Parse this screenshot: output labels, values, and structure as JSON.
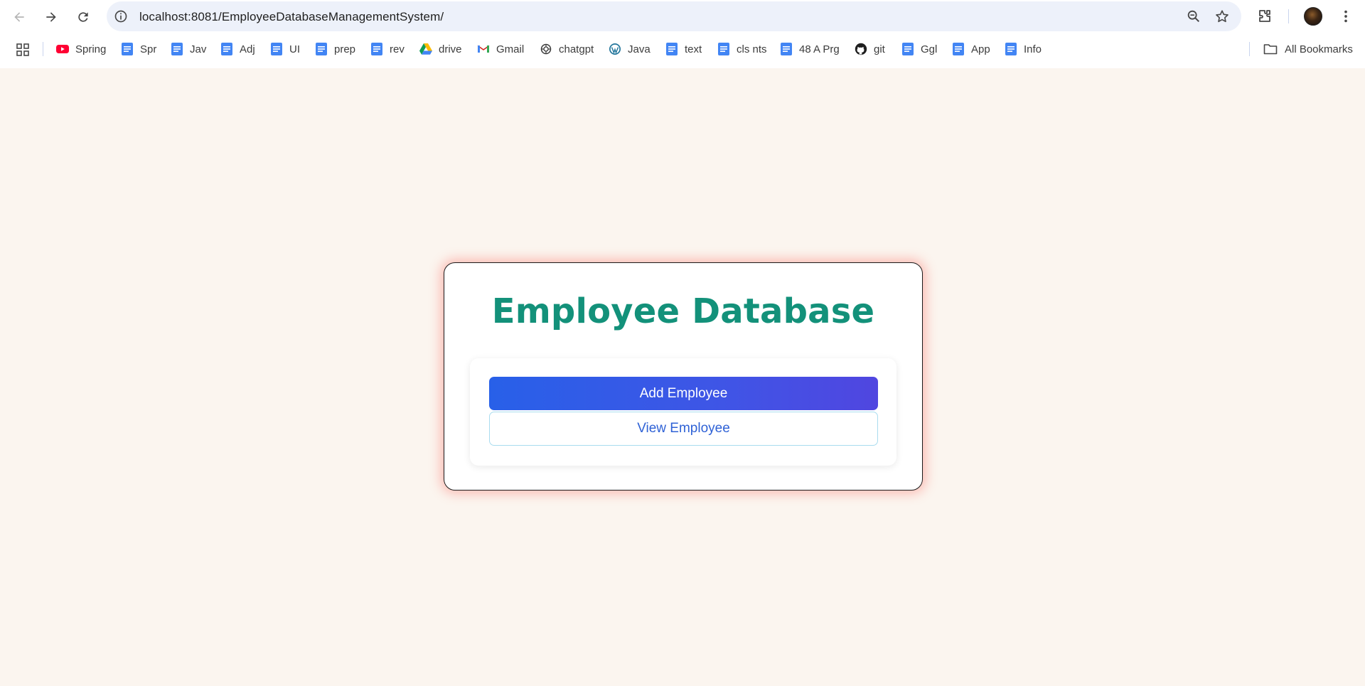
{
  "browser": {
    "url": "localhost:8081/EmployeeDatabaseManagementSystem/",
    "bookmarks": [
      {
        "label": "Spring",
        "icon": "youtube-icon"
      },
      {
        "label": "Spr",
        "icon": "docs-icon"
      },
      {
        "label": "Jav",
        "icon": "docs-icon"
      },
      {
        "label": "Adj",
        "icon": "docs-icon"
      },
      {
        "label": "UI",
        "icon": "docs-icon"
      },
      {
        "label": "prep",
        "icon": "docs-icon"
      },
      {
        "label": "rev",
        "icon": "docs-icon"
      },
      {
        "label": "drive",
        "icon": "drive-icon"
      },
      {
        "label": "Gmail",
        "icon": "gmail-icon"
      },
      {
        "label": "chatgpt",
        "icon": "chatgpt-icon"
      },
      {
        "label": "Java",
        "icon": "wordpress-icon"
      },
      {
        "label": "text",
        "icon": "docs-icon"
      },
      {
        "label": "cls nts",
        "icon": "docs-icon"
      },
      {
        "label": "48 A Prg",
        "icon": "docs-icon"
      },
      {
        "label": "git",
        "icon": "github-icon"
      },
      {
        "label": "Ggl",
        "icon": "docs-icon"
      },
      {
        "label": "App",
        "icon": "docs-icon"
      },
      {
        "label": "Info",
        "icon": "docs-icon"
      }
    ],
    "all_bookmarks_label": "All Bookmarks"
  },
  "page": {
    "title": "Employee Database",
    "add_button_label": "Add Employee",
    "view_button_label": "View Employee"
  },
  "colors": {
    "page_background": "#fbf5ef",
    "title": "#13917a",
    "add_button_start": "#2860e8",
    "add_button_end": "#5046e0",
    "view_button_text": "#2f62d6",
    "card_glow": "#ff5a50"
  }
}
